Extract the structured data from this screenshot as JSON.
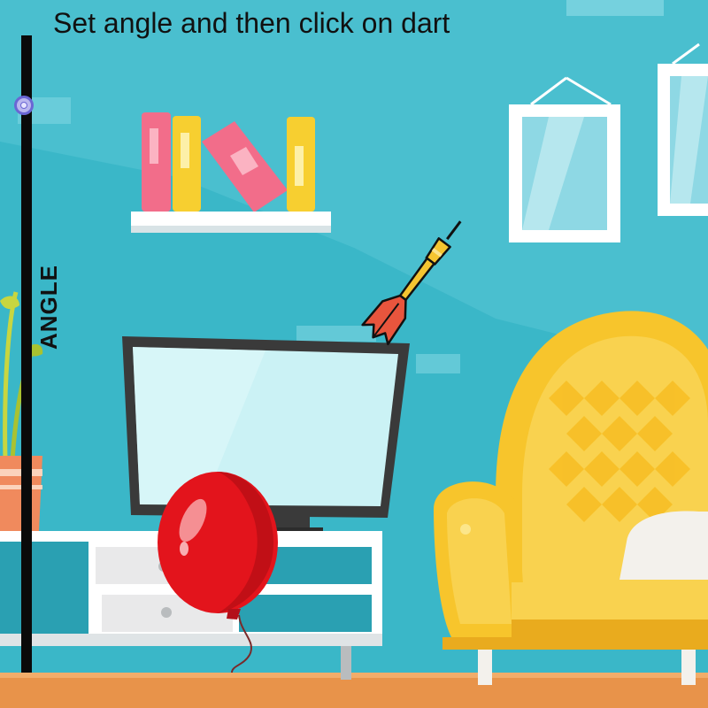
{
  "instruction": "Set angle and then click on dart",
  "slider": {
    "label": "ANGLE",
    "level_fraction": 0.11,
    "track_color": "#0a0a0a",
    "handle_color": "#b9b6ee"
  },
  "icons": {
    "dart": "dart-icon",
    "balloon": "balloon-icon"
  },
  "colors": {
    "wall": "#3ab7c8",
    "floor": "#e8934a",
    "sofa": "#f7c52c",
    "balloon": "#e3141c",
    "dart_flight": "#e8553d",
    "dart_barrel": "#f5c531"
  }
}
